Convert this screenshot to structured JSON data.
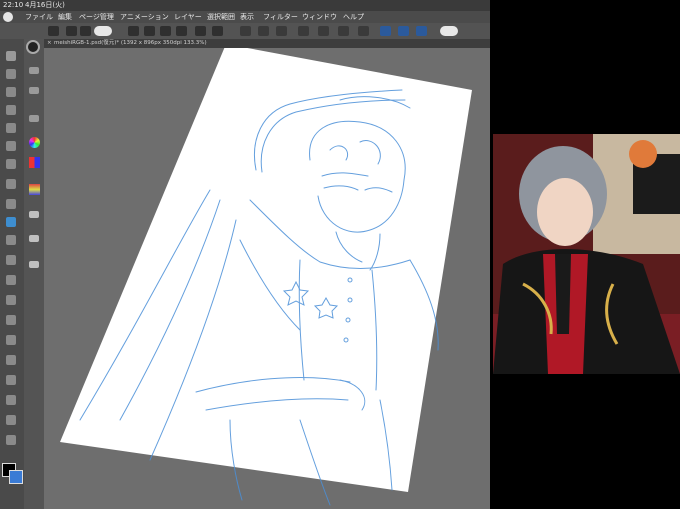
{
  "status": {
    "time": "22:10",
    "date": "4月16日(火)"
  },
  "menu": [
    "ファイル",
    "編集",
    "ページ管理",
    "アニメーション",
    "レイヤー",
    "選択範囲",
    "表示",
    "フィルター",
    "ウィンドウ",
    "ヘルプ"
  ],
  "tab": {
    "title": "meishiRGB-1.psd(復元)* (1392 x 896px 350dpi 133.3%)",
    "close": "×"
  },
  "icons": {
    "app": "clip-studio-logo",
    "toolbar": [
      "grid-icon",
      "undo-icon",
      "redo-icon",
      "new-file-icon",
      "open-file-icon",
      "save-icon",
      "rotate-icon",
      "transform-icon",
      "eraser-icon",
      "select-icon",
      "ruler-icon",
      "help-icon"
    ],
    "tools": [
      "zoom-icon",
      "move-icon",
      "operation-icon",
      "lasso-icon",
      "selection-icon",
      "eyedropper-icon",
      "pen-icon",
      "pencil-icon",
      "brush-icon",
      "airbrush-icon",
      "decoration-icon",
      "eraser-tool-icon",
      "blend-icon",
      "fill-icon",
      "gradient-icon",
      "figure-icon",
      "frame-icon",
      "ruler-tool-icon",
      "text-icon",
      "balloon-icon",
      "line-correct-icon"
    ],
    "subtools": [
      "magnifier-icon",
      "hand-icon",
      "rotate-view-icon",
      "color-wheel-icon",
      "color-set-icon",
      "layer-icon",
      "brush-size-icon",
      "layer-property-icon",
      "navigator-icon"
    ]
  },
  "colors": {
    "main": "#000000",
    "sub": "#3a7bd5",
    "sketch": "#4a8fd8"
  }
}
